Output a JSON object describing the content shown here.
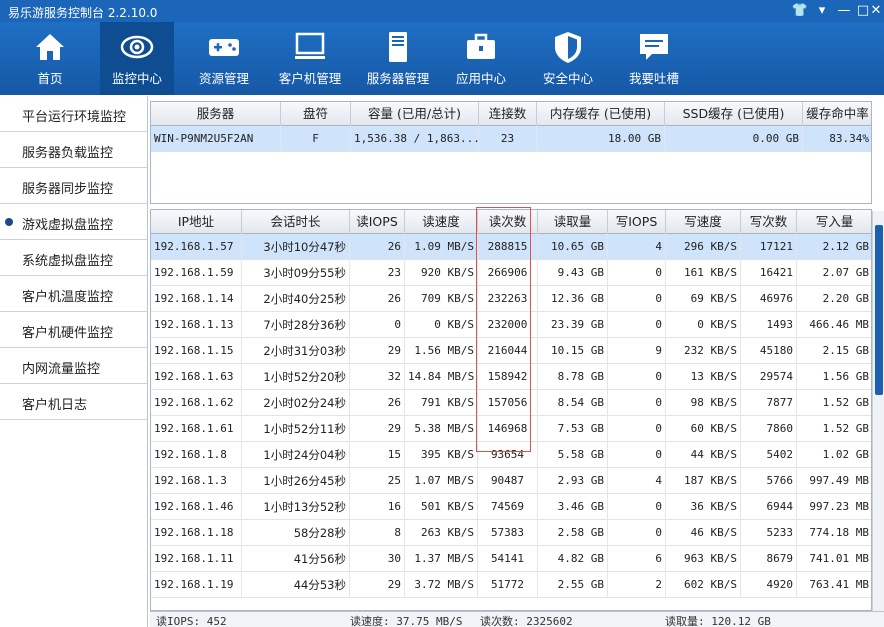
{
  "app": {
    "title": "易乐游服务控制台 2.2.10.0"
  },
  "window_controls": {
    "shirt": "👕",
    "dropdown": "▾",
    "minimize": "—",
    "restore": "□",
    "close": "✕"
  },
  "toolbar": {
    "items": [
      {
        "label": "首页",
        "icon": "home-icon"
      },
      {
        "label": "监控中心",
        "icon": "eye-icon",
        "active": true
      },
      {
        "label": "资源管理",
        "icon": "gamepad-icon"
      },
      {
        "label": "客户机管理",
        "icon": "monitor-icon"
      },
      {
        "label": "服务器管理",
        "icon": "server-icon"
      },
      {
        "label": "应用中心",
        "icon": "briefcase-icon"
      },
      {
        "label": "安全中心",
        "icon": "shield-icon"
      },
      {
        "label": "我要吐槽",
        "icon": "chat-icon"
      }
    ]
  },
  "sidebar": {
    "items": [
      {
        "label": "平台运行环境监控"
      },
      {
        "label": "服务器负载监控"
      },
      {
        "label": "服务器同步监控"
      },
      {
        "label": "游戏虚拟盘监控",
        "active": true
      },
      {
        "label": "系统虚拟盘监控"
      },
      {
        "label": "客户机温度监控"
      },
      {
        "label": "客户机硬件监控"
      },
      {
        "label": "内网流量监控"
      },
      {
        "label": "客户机日志"
      }
    ]
  },
  "server_table": {
    "headers": [
      "服务器",
      "盘符",
      "容量 (已用/总计)",
      "连接数",
      "内存缓存 (已使用)",
      "SSD缓存 (已使用)",
      "缓存命中率"
    ],
    "rows": [
      [
        "WIN-P9NM2U5F2AN",
        "F",
        "1,536.38 / 1,863....",
        "23",
        "18.00 GB",
        "0.00 GB",
        "83.34%"
      ]
    ]
  },
  "client_table": {
    "headers": [
      "IP地址",
      "会话时长",
      "读IOPS",
      "读速度",
      "读次数",
      "读取量",
      "写IOPS",
      "写速度",
      "写次数",
      "写入量"
    ],
    "rows": [
      [
        "192.168.1.57",
        "3小时10分47秒",
        "26",
        "1.09 MB/S",
        "288815",
        "10.65 GB",
        "4",
        "296 KB/S",
        "17121",
        "2.12 GB"
      ],
      [
        "192.168.1.59",
        "3小时09分55秒",
        "23",
        "920 KB/S",
        "266906",
        "9.43 GB",
        "0",
        "161 KB/S",
        "16421",
        "2.07 GB"
      ],
      [
        "192.168.1.14",
        "2小时40分25秒",
        "26",
        "709 KB/S",
        "232263",
        "12.36 GB",
        "0",
        "69 KB/S",
        "46976",
        "2.20 GB"
      ],
      [
        "192.168.1.13",
        "7小时28分36秒",
        "0",
        "0 KB/S",
        "232000",
        "23.39 GB",
        "0",
        "0 KB/S",
        "1493",
        "466.46 MB"
      ],
      [
        "192.168.1.15",
        "2小时31分03秒",
        "29",
        "1.56 MB/S",
        "216044",
        "10.15 GB",
        "9",
        "232 KB/S",
        "45180",
        "2.15 GB"
      ],
      [
        "192.168.1.63",
        "1小时52分20秒",
        "32",
        "14.84 MB/S",
        "158942",
        "8.78 GB",
        "0",
        "13 KB/S",
        "29574",
        "1.56 GB"
      ],
      [
        "192.168.1.62",
        "2小时02分24秒",
        "26",
        "791 KB/S",
        "157056",
        "8.54 GB",
        "0",
        "98 KB/S",
        "7877",
        "1.52 GB"
      ],
      [
        "192.168.1.61",
        "1小时52分11秒",
        "29",
        "5.38 MB/S",
        "146968",
        "7.53 GB",
        "0",
        "60 KB/S",
        "7860",
        "1.52 GB"
      ],
      [
        "192.168.1.8",
        "1小时24分04秒",
        "15",
        "395 KB/S",
        "93654",
        "5.58 GB",
        "0",
        "44 KB/S",
        "5402",
        "1.02 GB"
      ],
      [
        "192.168.1.3",
        "1小时26分45秒",
        "25",
        "1.07 MB/S",
        "90487",
        "2.93 GB",
        "4",
        "187 KB/S",
        "5766",
        "997.49 MB"
      ],
      [
        "192.168.1.46",
        "1小时13分52秒",
        "16",
        "501 KB/S",
        "74569",
        "3.46 GB",
        "0",
        "36 KB/S",
        "6944",
        "997.23 MB"
      ],
      [
        "192.168.1.18",
        "58分28秒",
        "8",
        "263 KB/S",
        "57383",
        "2.58 GB",
        "0",
        "46 KB/S",
        "5233",
        "774.18 MB"
      ],
      [
        "192.168.1.11",
        "41分56秒",
        "30",
        "1.37 MB/S",
        "54141",
        "4.82 GB",
        "6",
        "963 KB/S",
        "8679",
        "741.01 MB"
      ],
      [
        "192.168.1.19",
        "44分53秒",
        "29",
        "3.72 MB/S",
        "51772",
        "2.55 GB",
        "2",
        "602 KB/S",
        "4920",
        "763.41 MB"
      ]
    ]
  },
  "footer": {
    "read_iops": "读IOPS: 452",
    "read_speed": "读速度: 37.75 MB/S",
    "read_count": "读次数: 2325602",
    "read_amount": "读取量: 120.12 GB"
  },
  "colors": {
    "accent": "#1b66b8",
    "selected_row": "#cfe3fb",
    "highlight": "#d9534f"
  }
}
